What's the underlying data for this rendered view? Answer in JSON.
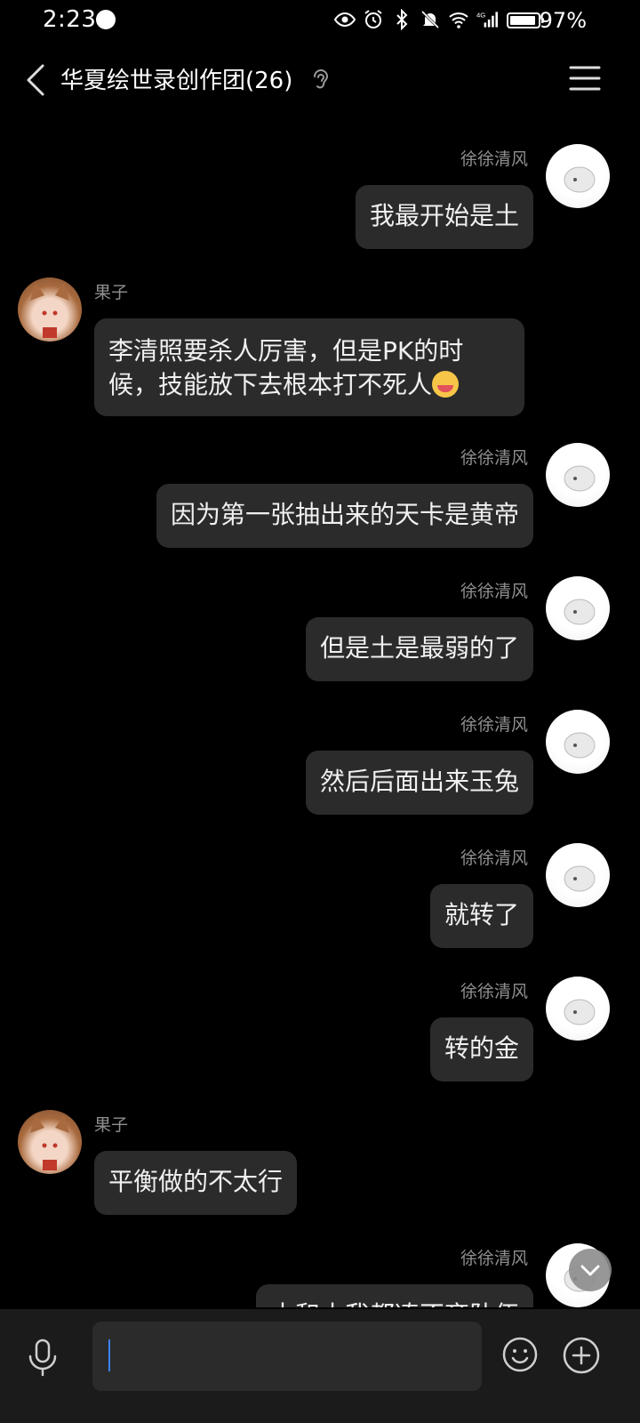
{
  "status_bar": {
    "time": "2:23",
    "battery": "97%",
    "network": "4G"
  },
  "header": {
    "title": "华夏绘世录创作团(26)"
  },
  "messages": [
    {
      "sender": "徐徐清风",
      "text": "我最开始是土",
      "mine": true
    },
    {
      "sender": "果子",
      "text": "李清照要杀人厉害，但是PK的时候，技能放下去根本打不死人",
      "mine": false,
      "emoji": "face-savoring-food"
    },
    {
      "sender": "徐徐清风",
      "text": "因为第一张抽出来的天卡是黄帝",
      "mine": true
    },
    {
      "sender": "徐徐清风",
      "text": "但是土是最弱的了",
      "mine": true
    },
    {
      "sender": "徐徐清风",
      "text": "然后后面出来玉兔",
      "mine": true
    },
    {
      "sender": "徐徐清风",
      "text": "就转了",
      "mine": true
    },
    {
      "sender": "徐徐清风",
      "text": "转的金",
      "mine": true
    },
    {
      "sender": "果子",
      "text": "平衡做的不太行",
      "mine": false
    },
    {
      "sender": "徐徐清风",
      "text": "木和水我都凑不齐队伍",
      "mine": true,
      "partial": true
    }
  ],
  "input": {
    "value": ""
  },
  "colors": {
    "background": "#000000",
    "bubble": "#2b2b2b",
    "name": "#8f8f8f",
    "input_bar": "#1b1b1b",
    "caret": "#3b82f6"
  },
  "icons": {
    "back": "chevron-left-icon",
    "ear": "ear-icon",
    "menu": "hamburger-menu-icon",
    "mic": "microphone-icon",
    "emoji": "smiley-icon",
    "plus": "plus-circle-icon",
    "scroll": "chevron-down-icon"
  }
}
